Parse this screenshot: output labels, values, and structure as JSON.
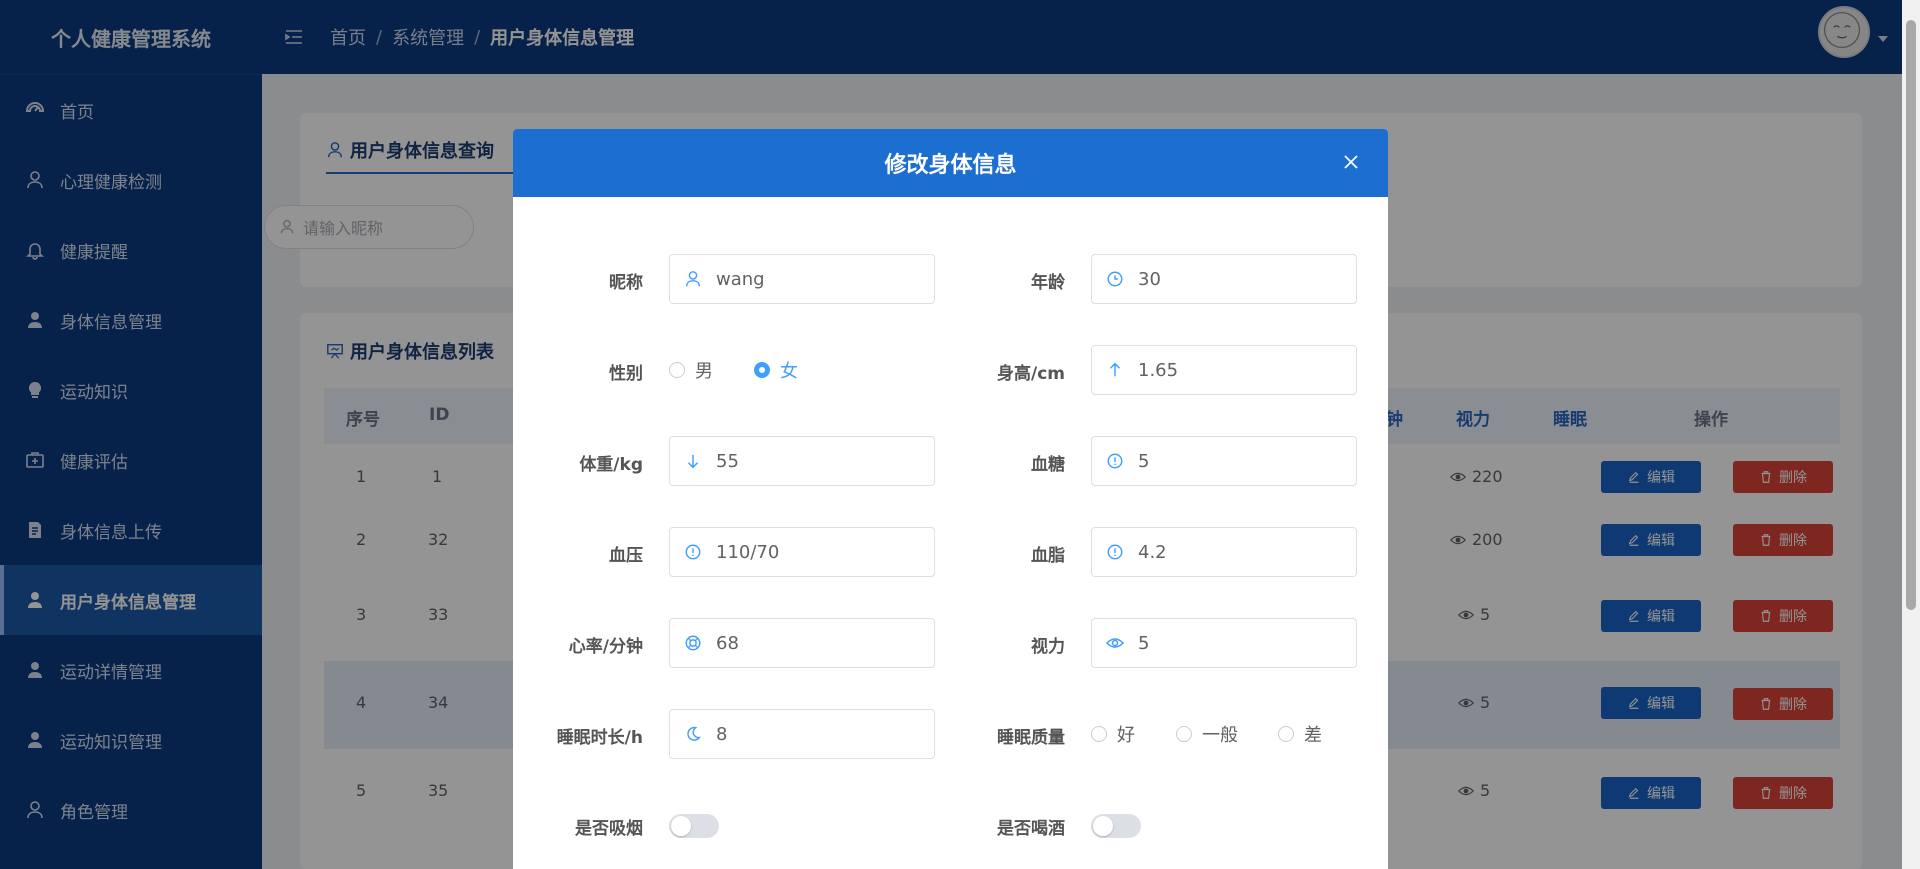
{
  "app": {
    "title": "个人健康管理系统"
  },
  "sidebar": {
    "items": [
      {
        "label": "首页",
        "icon": "dashboard-icon"
      },
      {
        "label": "心理健康检测",
        "icon": "user-icon"
      },
      {
        "label": "健康提醒",
        "icon": "bell-icon"
      },
      {
        "label": "身体信息管理",
        "icon": "user-solid-icon"
      },
      {
        "label": "运动知识",
        "icon": "bulb-icon"
      },
      {
        "label": "健康评估",
        "icon": "first-aid-icon"
      },
      {
        "label": "身体信息上传",
        "icon": "document-icon"
      },
      {
        "label": "用户身体信息管理",
        "icon": "user-solid-icon",
        "active": true
      },
      {
        "label": "运动详情管理",
        "icon": "user-solid-icon"
      },
      {
        "label": "运动知识管理",
        "icon": "user-solid-icon"
      },
      {
        "label": "角色管理",
        "icon": "user-icon"
      }
    ]
  },
  "header": {
    "breadcrumbs": [
      "首页",
      "系统管理",
      "用户身体信息管理"
    ],
    "separator": "/"
  },
  "query_card": {
    "title": "用户身体信息查询",
    "search_placeholder": "请输入昵称"
  },
  "list_card": {
    "title": "用户身体信息列表",
    "columns_visible": [
      "序号",
      "ID",
      "视力",
      "睡眠",
      "操作"
    ],
    "partial_column": "钟",
    "rows": [
      {
        "index": "1",
        "id": "1",
        "vision": "220"
      },
      {
        "index": "2",
        "id": "32",
        "vision": "200"
      },
      {
        "index": "3",
        "id": "33",
        "vision": "5"
      },
      {
        "index": "4",
        "id": "34",
        "vision": "5"
      },
      {
        "index": "5",
        "id": "35",
        "vision": "5"
      }
    ],
    "edit_label": "编辑",
    "delete_label": "删除"
  },
  "dialog": {
    "title": "修改身体信息",
    "fields": {
      "nickname": {
        "label": "昵称",
        "value": "wang"
      },
      "age": {
        "label": "年龄",
        "value": "30"
      },
      "gender": {
        "label": "性别",
        "options": [
          "男",
          "女"
        ],
        "selected": "女"
      },
      "height": {
        "label": "身高/cm",
        "value": "1.65"
      },
      "weight": {
        "label": "体重/kg",
        "value": "55"
      },
      "blood_sugar": {
        "label": "血糖",
        "value": "5"
      },
      "blood_pressure": {
        "label": "血压",
        "value": "110/70"
      },
      "blood_lipid": {
        "label": "血脂",
        "value": "4.2"
      },
      "heart_rate": {
        "label": "心率/分钟",
        "value": "68"
      },
      "vision": {
        "label": "视力",
        "value": "5"
      },
      "sleep_hours": {
        "label": "睡眠时长/h",
        "value": "8"
      },
      "sleep_quality": {
        "label": "睡眠质量",
        "options": [
          "好",
          "一般",
          "差"
        ],
        "selected": ""
      },
      "smoking": {
        "label": "是否吸烟",
        "on": false
      },
      "drinking": {
        "label": "是否喝酒",
        "on": false
      }
    }
  },
  "colors": {
    "sidebar_bg": "#0c3c82",
    "dialog_header": "#1c6fd1",
    "accent": "#409eff",
    "edit_button": "#1b63c4",
    "delete_button": "#d9443a"
  }
}
